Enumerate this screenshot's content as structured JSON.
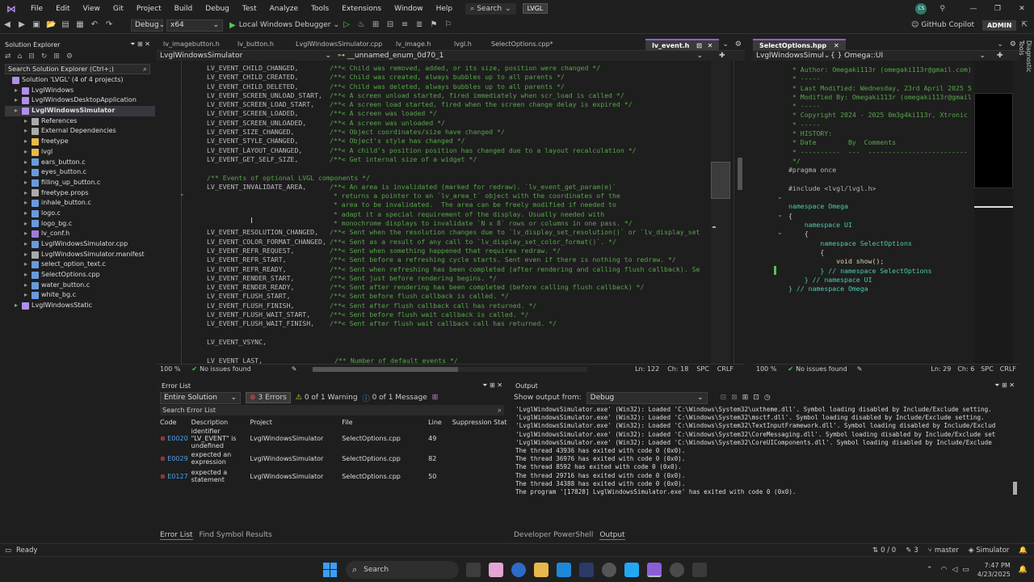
{
  "menu": {
    "items": [
      "File",
      "Edit",
      "View",
      "Git",
      "Project",
      "Build",
      "Debug",
      "Test",
      "Analyze",
      "Tools",
      "Extensions",
      "Window",
      "Help"
    ],
    "search": "Search",
    "solution_badge": "LVGL",
    "user_initials": "CS"
  },
  "toolbar": {
    "config": "Debug",
    "platform": "x64",
    "run_target": "Local Windows Debugger",
    "copilot": "GitHub Copilot",
    "admin": "ADMIN"
  },
  "solution_explorer": {
    "title": "Solution Explorer",
    "search_placeholder": "Search Solution Explorer (Ctrl+;)",
    "items": [
      {
        "label": "Solution 'LVGL' (4 of 4 projects)",
        "indent": 0
      },
      {
        "label": "LvglWindows",
        "indent": 1
      },
      {
        "label": "LvglWindowsDesktopApplication",
        "indent": 1
      },
      {
        "label": "LvglWindowsSimulator",
        "indent": 1,
        "bold": true
      },
      {
        "label": "References",
        "indent": 2
      },
      {
        "label": "External Dependencies",
        "indent": 2
      },
      {
        "label": "freetype",
        "indent": 2
      },
      {
        "label": "lvgl",
        "indent": 2
      },
      {
        "label": "ears_button.c",
        "indent": 2
      },
      {
        "label": "eyes_button.c",
        "indent": 2
      },
      {
        "label": "filling_up_button.c",
        "indent": 2
      },
      {
        "label": "freetype.props",
        "indent": 2
      },
      {
        "label": "inhale_button.c",
        "indent": 2
      },
      {
        "label": "logo.c",
        "indent": 2
      },
      {
        "label": "logo_bg.c",
        "indent": 2
      },
      {
        "label": "lv_conf.h",
        "indent": 2
      },
      {
        "label": "LvglWindowsSimulator.cpp",
        "indent": 2
      },
      {
        "label": "LvglWindowsSimulator.manifest",
        "indent": 2
      },
      {
        "label": "select_option_text.c",
        "indent": 2
      },
      {
        "label": "SelectOptions.cpp",
        "indent": 2
      },
      {
        "label": "water_button.c",
        "indent": 2
      },
      {
        "label": "white_bg.c",
        "indent": 2
      },
      {
        "label": "LvglWindowsStatic",
        "indent": 1
      }
    ]
  },
  "editor_tabs": {
    "items": [
      "lv_imagebutton.h",
      "lv_button.h",
      "LvglWindowsSimulator.cpp",
      "lv_image.h",
      "lvgl.h",
      "SelectOptions.cpp*"
    ],
    "active": "lv_event.h",
    "scope_project": "LvglWindowsSimulator",
    "scope_symbol": "__unnamed_enum_0d70_1"
  },
  "editor": {
    "lines": [
      {
        "id": "LV_EVENT_CHILD_CHANGED,",
        "c": "/**< Child was removed, added, or its size, position were changed */"
      },
      {
        "id": "LV_EVENT_CHILD_CREATED,",
        "c": "/**< Child was created, always bubbles up to all parents */"
      },
      {
        "id": "LV_EVENT_CHILD_DELETED,",
        "c": "/**< Child was deleted, always bubbles up to all parents */"
      },
      {
        "id": "LV_EVENT_SCREEN_UNLOAD_START,",
        "c": "/**< A screen unload started, fired immediately when scr_load is called */"
      },
      {
        "id": "LV_EVENT_SCREEN_LOAD_START,",
        "c": "/**< A screen load started, fired when the screen change delay is expired */"
      },
      {
        "id": "LV_EVENT_SCREEN_LOADED,",
        "c": "/**< A screen was loaded */"
      },
      {
        "id": "LV_EVENT_SCREEN_UNLOADED,",
        "c": "/**< A screen was unloaded */"
      },
      {
        "id": "LV_EVENT_SIZE_CHANGED,",
        "c": "/**< Object coordinates/size have changed */"
      },
      {
        "id": "LV_EVENT_STYLE_CHANGED,",
        "c": "/**< Object's style has changed */"
      },
      {
        "id": "LV_EVENT_LAYOUT_CHANGED,",
        "c": "/**< A child's position position has changed due to a layout recalculation */"
      },
      {
        "id": "LV_EVENT_GET_SELF_SIZE,",
        "c": "/**< Get internal size of a widget */"
      },
      {
        "id": "",
        "c": ""
      },
      {
        "id": "",
        "c": "/** Events of optional LVGL components */"
      },
      {
        "id": "LV_EVENT_INVALIDATE_AREA,",
        "c": "/**< An area is invalidated (marked for redraw). `lv_event_get_param(e)`"
      },
      {
        "id": "",
        "c": " * returns a pointer to an `lv_area_t` object with the coordinates of the"
      },
      {
        "id": "",
        "c": " * area to be invalidated.  The area can be freely modified if needed to"
      },
      {
        "id": "",
        "c": " * adapt it a special requirement of the display. Usually needed with"
      },
      {
        "id": "",
        "c": " * monochrome displays to invalidate `N x 8` rows or columns in one pass. */"
      },
      {
        "id": "LV_EVENT_RESOLUTION_CHANGED,",
        "c": "/**< Sent when the resolution changes due to `lv_display_set_resolution()` or `lv_display_set"
      },
      {
        "id": "LV_EVENT_COLOR_FORMAT_CHANGED,",
        "c": "/**< Sent as a result of any call to `lv_display_set_color_format()`. */"
      },
      {
        "id": "LV_EVENT_REFR_REQUEST,",
        "c": "/**< Sent when something happened that requires redraw. */"
      },
      {
        "id": "LV_EVENT_REFR_START,",
        "c": "/**< Sent before a refreshing cycle starts. Sent even if there is nothing to redraw. */"
      },
      {
        "id": "LV_EVENT_REFR_READY,",
        "c": "/**< Sent when refreshing has been completed (after rendering and calling flush callback). Se"
      },
      {
        "id": "LV_EVENT_RENDER_START,",
        "c": "/**< Sent just before rendering begins. */"
      },
      {
        "id": "LV_EVENT_RENDER_READY,",
        "c": "/**< Sent after rendering has been completed (before calling flush callback) */"
      },
      {
        "id": "LV_EVENT_FLUSH_START,",
        "c": "/**< Sent before flush callback is called. */"
      },
      {
        "id": "LV_EVENT_FLUSH_FINISH,",
        "c": "/**< Sent after flush callback call has returned. */"
      },
      {
        "id": "LV_EVENT_FLUSH_WAIT_START,",
        "c": "/**< Sent before flush wait callback is called. */"
      },
      {
        "id": "LV_EVENT_FLUSH_WAIT_FINISH,",
        "c": "/**< Sent after flush wait callback call has returned. */"
      },
      {
        "id": "",
        "c": ""
      },
      {
        "id": "LV_EVENT_VSYNC,",
        "c": ""
      },
      {
        "id": "",
        "c": ""
      },
      {
        "id": "LV_EVENT_LAST,",
        "c": "/** Number of default events */"
      }
    ],
    "zoom": "100 %",
    "issues": "No issues found",
    "ln": "Ln: 122",
    "ch": "Ch: 18",
    "spc": "SPC",
    "eol": "CRLF"
  },
  "right_editor": {
    "tab": "SelectOptions.hpp",
    "scope_project": "LvglWindowsSimul",
    "scope_symbol": "{ } Omega::UI",
    "lines": [
      " * Author: Omegaki113r (omegaki113r@gmail.com)",
      " * -----",
      " * Last Modified: Wednesday, 23rd April 2025 5",
      " * Modified By: Omegaki113r (omegaki113r@gmail",
      " * -----",
      " * Copyright 2024 - 2025 0m3g4ki113r, Xtronic",
      " * -----",
      " * HISTORY:",
      " * Date        By  Comments",
      " * ----------  ---  -------------------------",
      " */",
      "#pragma once",
      "",
      "#include <lvgl/lvgl.h>",
      "",
      "namespace Omega",
      "{",
      "    namespace UI",
      "    {",
      "        namespace SelectOptions",
      "        {",
      "            void show();",
      "        } // namespace SelectOptions",
      "    } // namespace UI",
      "} // namespace Omega"
    ],
    "zoom": "100 %",
    "issues": "No issues found",
    "ln": "Ln: 29",
    "ch": "Ch: 6",
    "spc": "SPC",
    "eol": "CRLF"
  },
  "error_list": {
    "title": "Error List",
    "scope": "Entire Solution",
    "errors": "3 Errors",
    "warnings": "0 of 1 Warning",
    "messages": "0 of 1 Message",
    "search_placeholder": "Search Error List",
    "columns": [
      "Code",
      "Description",
      "Project",
      "File",
      "Line",
      "Suppression Stat"
    ],
    "rows": [
      {
        "code": "E0020",
        "desc": "identifier \"LV_EVENT\" is undefined",
        "project": "LvglWindowsSimulator",
        "file": "SelectOptions.cpp",
        "line": "49"
      },
      {
        "code": "E0029",
        "desc": "expected an expression",
        "project": "LvglWindowsSimulator",
        "file": "SelectOptions.cpp",
        "line": "82"
      },
      {
        "code": "E0127",
        "desc": "expected a statement",
        "project": "LvglWindowsSimulator",
        "file": "SelectOptions.cpp",
        "line": "50"
      }
    ],
    "bottom_tabs": [
      "Error List",
      "Find Symbol Results"
    ]
  },
  "output": {
    "title": "Output",
    "show_from_label": "Show output from:",
    "source": "Debug",
    "lines": [
      "'LvglWindowsSimulator.exe' (Win32): Loaded 'C:\\Windows\\System32\\uxtheme.dll'. Symbol loading disabled by Include/Exclude setting.",
      "'LvglWindowsSimulator.exe' (Win32): Loaded 'C:\\Windows\\System32\\msctf.dll'. Symbol loading disabled by Include/Exclude setting.",
      "'LvglWindowsSimulator.exe' (Win32): Loaded 'C:\\Windows\\System32\\TextInputFramework.dll'. Symbol loading disabled by Include/Exclud",
      "'LvglWindowsSimulator.exe' (Win32): Loaded 'C:\\Windows\\System32\\CoreMessaging.dll'. Symbol loading disabled by Include/Exclude set",
      "'LvglWindowsSimulator.exe' (Win32): Loaded 'C:\\Windows\\System32\\CoreUIComponents.dll'. Symbol loading disabled by Include/Exclude",
      "The thread 43936 has exited with code 0 (0x0).",
      "The thread 36976 has exited with code 0 (0x0).",
      "The thread 8592 has exited with code 0 (0x0).",
      "The thread 29716 has exited with code 0 (0x0).",
      "The thread 34388 has exited with code 0 (0x0).",
      "The program '[17828] LvglWindowsSimulator.exe' has exited with code 0 (0x0)."
    ],
    "bottom_tabs": [
      "Developer PowerShell",
      "Output"
    ]
  },
  "statusbar": {
    "ready": "Ready",
    "changes": "0 / 0",
    "commits": "3",
    "branch": "master",
    "repo": "Simulator"
  },
  "taskbar": {
    "search": "Search",
    "time": "7:47 PM",
    "date": "4/23/2025"
  },
  "side_label": "Diagnostic Tools"
}
